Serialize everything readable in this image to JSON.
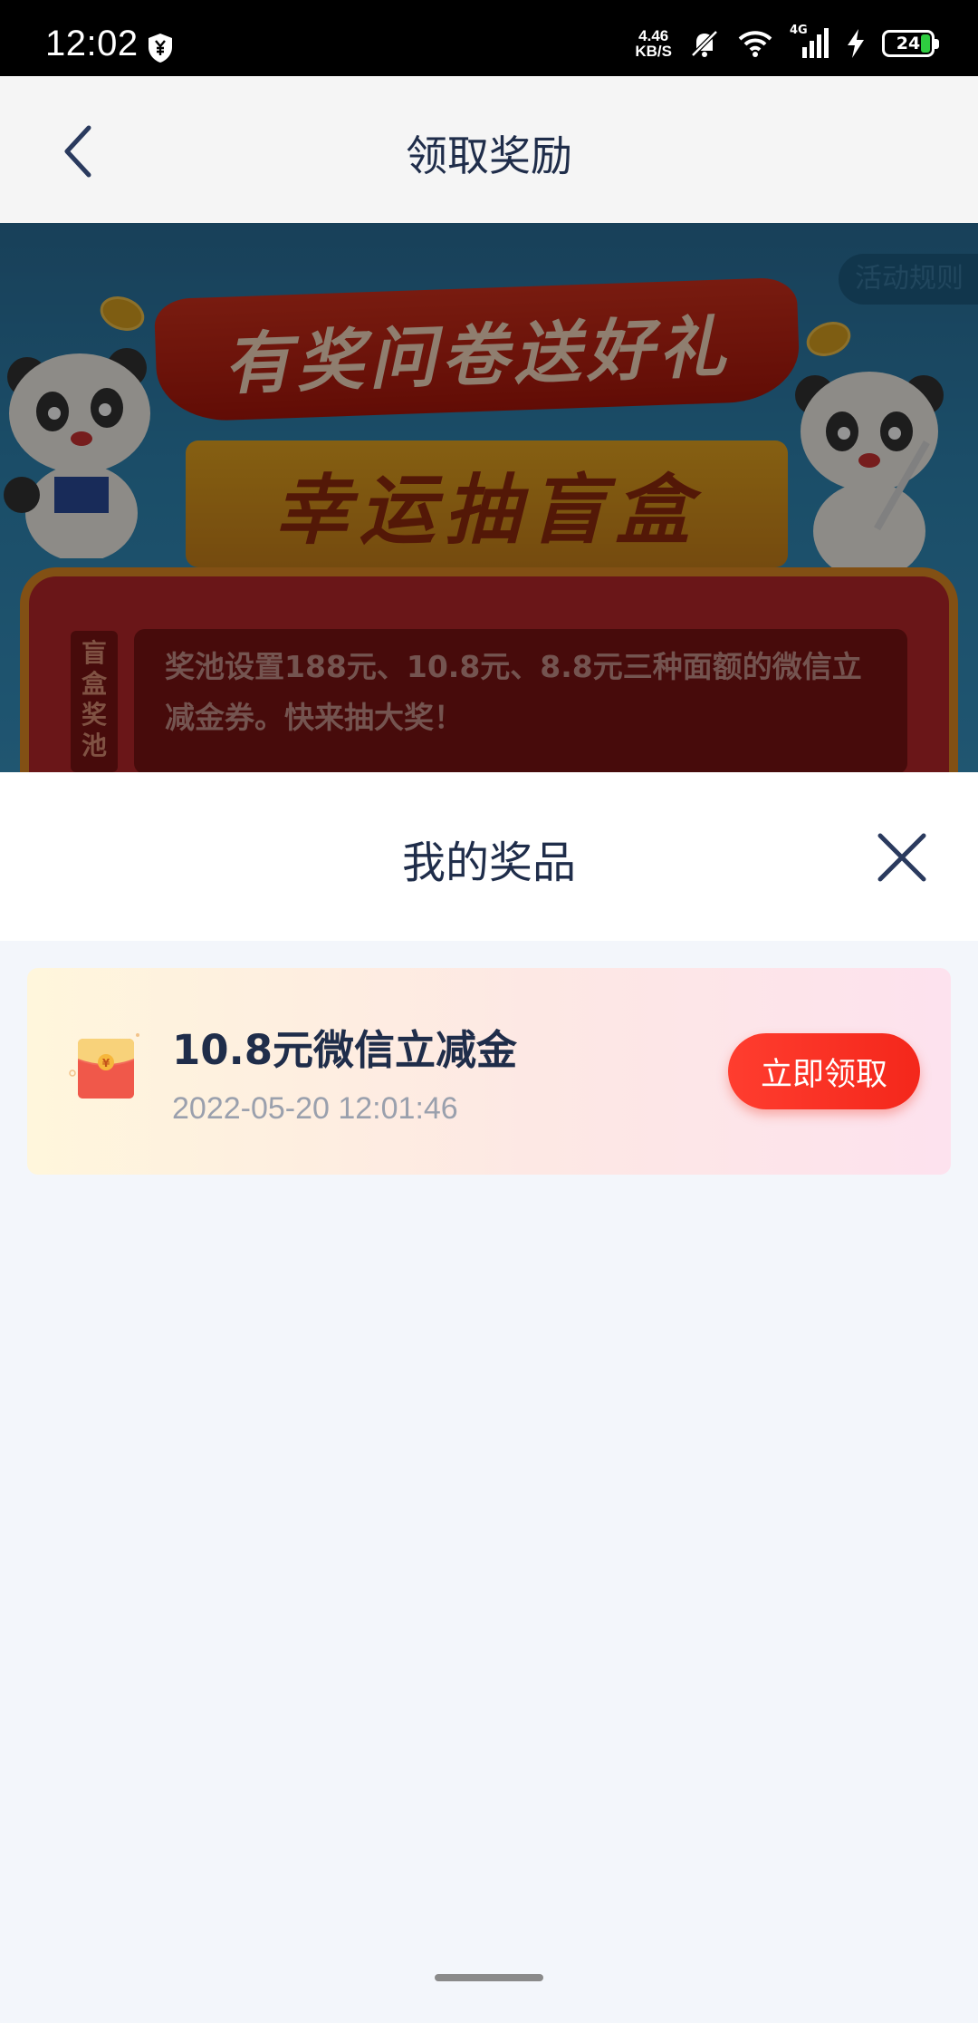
{
  "status_bar": {
    "time": "12:02",
    "net_speed_value": "4.46",
    "net_speed_unit": "KB/S",
    "signal_label": "4G",
    "battery_level": "24"
  },
  "header": {
    "title": "领取奖励"
  },
  "banner": {
    "rules_label": "活动规则",
    "ribbon_text": "有奖问卷送好礼",
    "box_title": "幸运抽盲盒",
    "prize_pool_tag": "盲盒奖池",
    "prize_pool_description": "奖池设置188元、10.8元、8.8元三种面额的微信立减金券。快来抽大奖！"
  },
  "sheet": {
    "title": "我的奖品",
    "prizes": [
      {
        "name": "10.8元微信立减金",
        "time": "2022-05-20 12:01:46",
        "action_label": "立即领取"
      }
    ]
  },
  "colors": {
    "accent": "#f4271b",
    "title_text": "#1f2d4a",
    "muted_text": "#9aa0ad",
    "page_background": "#f3f6fb"
  },
  "icons": {
    "back": "back-chevron-icon",
    "close": "close-icon",
    "envelope": "red-envelope-icon"
  }
}
